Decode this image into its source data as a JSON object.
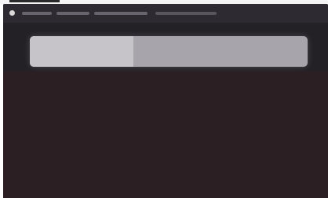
{
  "window": {
    "title_bar": {
      "title": ""
    }
  },
  "search": {
    "placeholder": "",
    "value": ""
  }
}
